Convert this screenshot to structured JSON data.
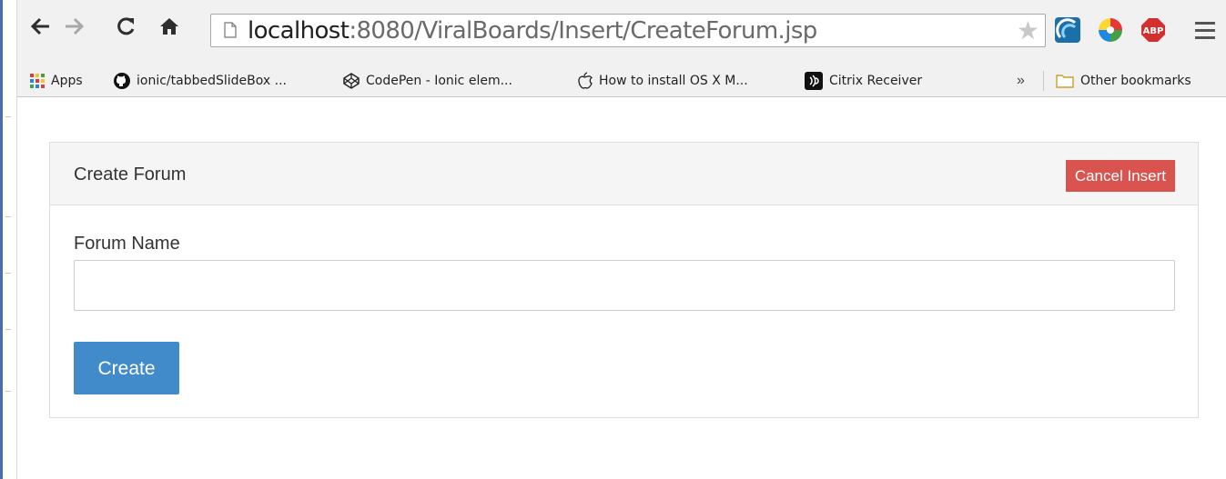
{
  "browser": {
    "url_host": "localhost",
    "url_rest": ":8080/ViralBoards/Insert/CreateForum.jsp"
  },
  "bookmarks": {
    "items": [
      {
        "label": "Apps",
        "icon": "apps-grid-icon"
      },
      {
        "label": "ionic/tabbedSlideBox ...",
        "icon": "github-icon"
      },
      {
        "label": "CodePen - Ionic elem...",
        "icon": "codepen-icon"
      },
      {
        "label": "How to install OS X M...",
        "icon": "apple-icon"
      },
      {
        "label": "Citrix Receiver",
        "icon": "citrix-icon"
      }
    ],
    "more": "»",
    "other": "Other bookmarks"
  },
  "panel": {
    "title": "Create Forum",
    "cancel_label": "Cancel Insert",
    "field_label": "Forum Name",
    "field_value": "",
    "submit_label": "Create"
  },
  "colors": {
    "danger": "#d9534f",
    "primary": "#428bca",
    "panel_heading": "#f5f5f5"
  }
}
